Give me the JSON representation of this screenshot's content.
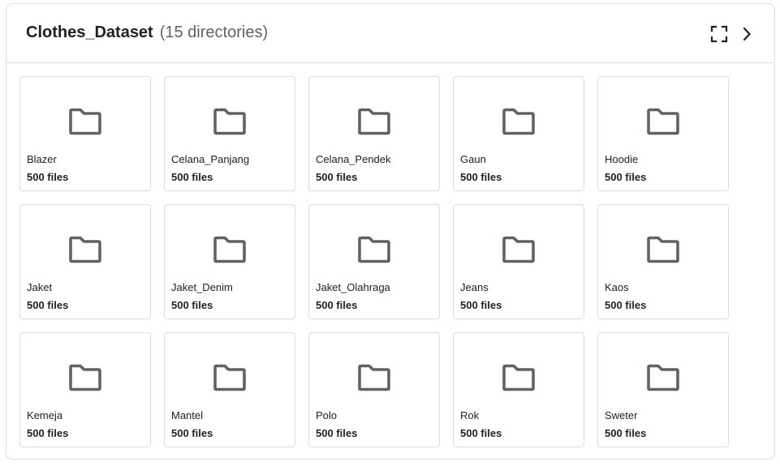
{
  "header": {
    "title": "Clothes_Dataset",
    "subtitle": "(15 directories)"
  },
  "icons": {
    "expand": "fullscreen-icon",
    "next": "chevron-right-icon",
    "folder": "folder-icon"
  },
  "directories": [
    {
      "name": "Blazer",
      "count": "500 files"
    },
    {
      "name": "Celana_Panjang",
      "count": "500 files"
    },
    {
      "name": "Celana_Pendek",
      "count": "500 files"
    },
    {
      "name": "Gaun",
      "count": "500 files"
    },
    {
      "name": "Hoodie",
      "count": "500 files"
    },
    {
      "name": "Jaket",
      "count": "500 files"
    },
    {
      "name": "Jaket_Denim",
      "count": "500 files"
    },
    {
      "name": "Jaket_Olahraga",
      "count": "500 files"
    },
    {
      "name": "Jeans",
      "count": "500 files"
    },
    {
      "name": "Kaos",
      "count": "500 files"
    },
    {
      "name": "Kemeja",
      "count": "500 files"
    },
    {
      "name": "Mantel",
      "count": "500 files"
    },
    {
      "name": "Polo",
      "count": "500 files"
    },
    {
      "name": "Rok",
      "count": "500 files"
    },
    {
      "name": "Sweter",
      "count": "500 files"
    }
  ]
}
